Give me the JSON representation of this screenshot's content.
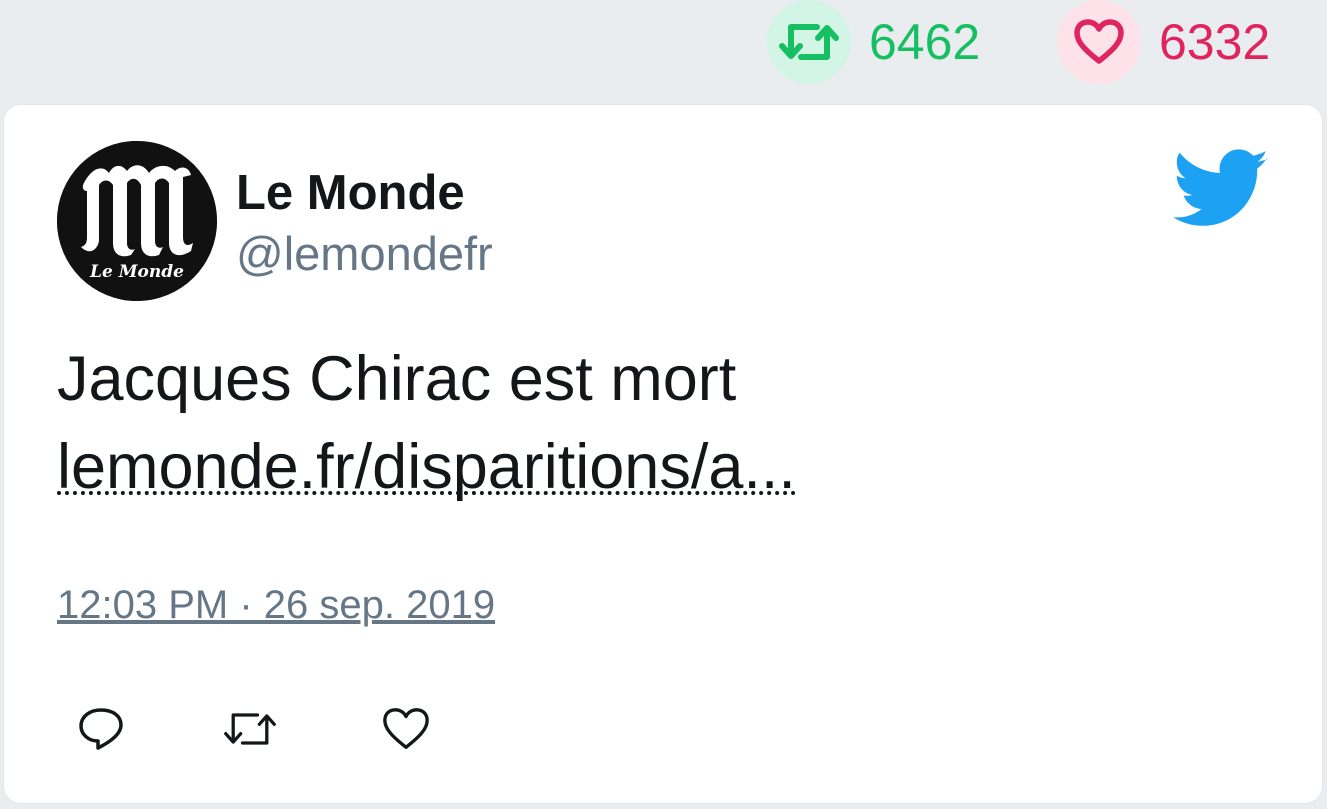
{
  "stats": {
    "retweet_count": "6462",
    "like_count": "6332",
    "retweet_icon": "retweet-icon",
    "like_icon": "heart-icon"
  },
  "tweet": {
    "author": {
      "display_name": "Le Monde",
      "handle": "@lemondefr",
      "avatar_icon": "le-monde-logo"
    },
    "platform_icon": "twitter-bird-icon",
    "text": "Jacques Chirac est mort",
    "link_text": "lemonde.fr/disparitions/a...",
    "timestamp": "12:03 PM · 26 sep. 2019"
  },
  "actions": {
    "reply_icon": "reply-icon",
    "retweet_icon": "retweet-icon",
    "like_icon": "heart-icon"
  },
  "colors": {
    "background": "#e9edf0",
    "card": "#ffffff",
    "retweet_green": "#17bf63",
    "like_red": "#e0245e",
    "twitter_blue": "#1da1f2",
    "secondary_text": "#657786",
    "primary_text": "#14171a"
  }
}
